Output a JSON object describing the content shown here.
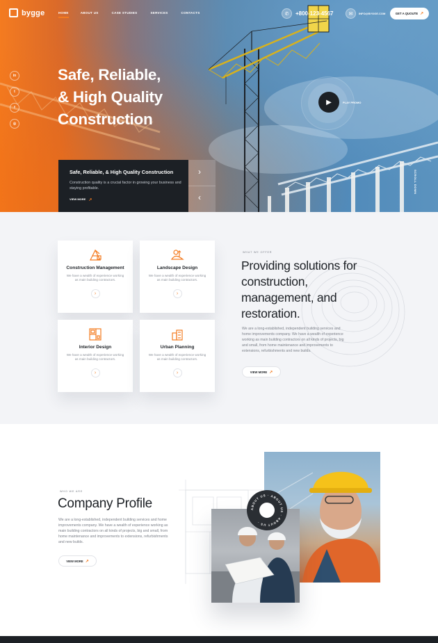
{
  "brand": {
    "name": "bygge"
  },
  "nav": {
    "items": [
      {
        "label": "HOME",
        "active": true
      },
      {
        "label": "ABOUT US",
        "active": false
      },
      {
        "label": "CASE STUDIES",
        "active": false
      },
      {
        "label": "SERVICES",
        "active": false
      },
      {
        "label": "CONTACTS",
        "active": false
      }
    ],
    "phone": "+800-123-4567",
    "email": "INFO@BYGGE.COM",
    "quote_label": "GET A QUOUTE"
  },
  "socials": [
    "in",
    "tw",
    "f",
    "ig"
  ],
  "hero": {
    "title_lines": [
      "Safe, Reliable,",
      "& High Quality",
      "Construction"
    ],
    "play_label": "PLAY PROMO",
    "card_title": "Safe, Reliable, & High Quality Construction",
    "card_text": "Construction quality is a crucial factor in growing your business and staying profitable.",
    "card_link": "VIEW MORE",
    "scroll_label": "SCROLL DOWN"
  },
  "services": {
    "cards": [
      {
        "title": "Construction Management",
        "text": "We have a wealth of experience working as main building contractors.",
        "icon": "crane-icon"
      },
      {
        "title": "Landscape Design",
        "text": "We have a wealth of experience working as main building contractors.",
        "icon": "landscape-icon"
      },
      {
        "title": "Interior Design",
        "text": "We have a wealth of experience working as main building contractors.",
        "icon": "interior-icon"
      },
      {
        "title": "Urban Planning",
        "text": "We have a wealth of experience working as main building contractors.",
        "icon": "urban-icon"
      }
    ],
    "subtitle": "WHAT WE OFFER",
    "title": "Providing solutions for construction, management, and restoration.",
    "text": "We are a long-established, independent building services and home improvements company. We have a wealth of experience working as main building contractors on all kinds of projects, big and small, from home maintenance and improvements to extensions, refurbishments and new builds.",
    "button": "VIEW MORE"
  },
  "profile": {
    "subtitle": "WHO WE ARE",
    "title": "Company Profile",
    "text": "We are a long-established, independent building services and home improvements company. We have a wealth of experience working as main building contractors on all kinds of projects, big and small, from home maintenance and improvements to extensions, refurbishments and new builds.",
    "button": "VIEW MORE",
    "badge_text": "ABOUT US · ABOUT US · ABOUT US ·"
  },
  "colors": {
    "accent": "#f47b20",
    "dark": "#1c2025"
  }
}
